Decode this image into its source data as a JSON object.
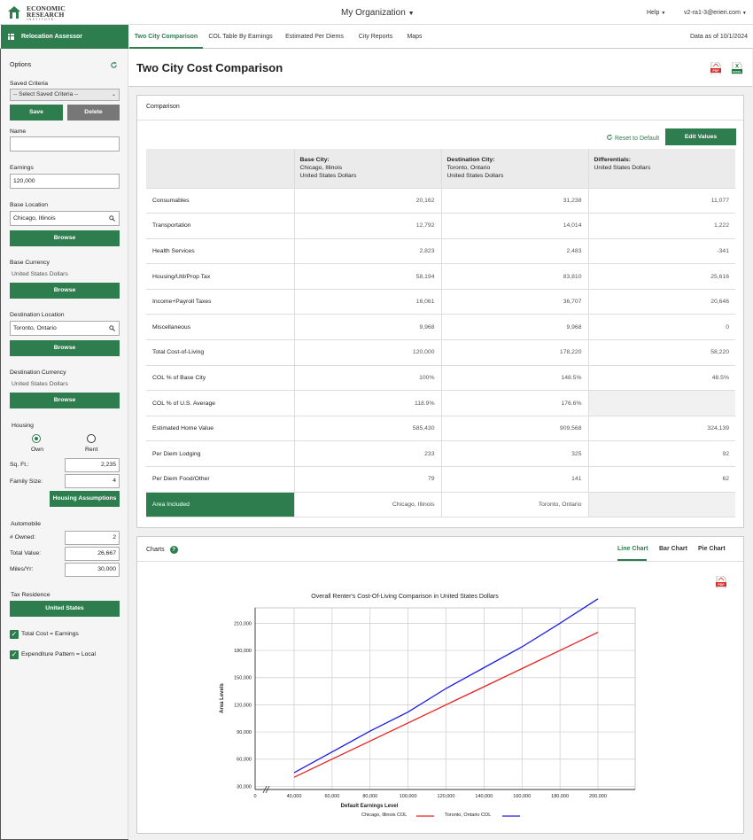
{
  "brand": {
    "line1": "ECONOMIC",
    "line2": "RESEARCH",
    "line3": "INSTITUTE"
  },
  "org_title": "My Organization",
  "help_label": "Help",
  "user_label": "v2-ra1-3@erieri.com",
  "app_name": "Relocation Assessor",
  "tabs": [
    {
      "label": "Two City Comparison",
      "active": true
    },
    {
      "label": "COL Table By Earnings",
      "active": false
    },
    {
      "label": "Estimated Per Diems",
      "active": false
    },
    {
      "label": "City Reports",
      "active": false
    },
    {
      "label": "Maps",
      "active": false
    }
  ],
  "data_as_of": "Data as of 10/1/2024",
  "sidebar": {
    "options_label": "Options",
    "saved_criteria_label": "Saved Criteria",
    "saved_criteria_placeholder": "-- Select Saved Criteria --",
    "save_label": "Save",
    "delete_label": "Delete",
    "name_label": "Name",
    "name_value": "",
    "earnings_label": "Earnings",
    "earnings_value": "120,000",
    "base_location_label": "Base Location",
    "base_location_value": "Chicago, Illinois",
    "browse_label": "Browse",
    "base_currency_label": "Base Currency",
    "base_currency_value": "United States Dollars",
    "dest_location_label": "Destination Location",
    "dest_location_value": "Toronto, Ontario",
    "dest_currency_label": "Destination Currency",
    "dest_currency_value": "United States Dollars",
    "housing_label": "Housing",
    "own_label": "Own",
    "rent_label": "Rent",
    "housing_selected": "Own",
    "sqft_label": "Sq. Ft.:",
    "sqft_value": "2,235",
    "family_label": "Family Size:",
    "family_value": "4",
    "housing_assumptions_label": "Housing Assumptions",
    "automobile_label": "Automobile",
    "owned_label": "# Owned:",
    "owned_value": "2",
    "total_value_label": "Total Value:",
    "total_value_value": "26,667",
    "miles_label": "Miles/Yr:",
    "miles_value": "30,000",
    "tax_residence_label": "Tax Residence",
    "tax_residence_value": "United States",
    "total_cost_label": "Total Cost = Earnings",
    "total_cost_checked": true,
    "expenditure_label": "Expenditure Pattern = Local",
    "expenditure_checked": true
  },
  "page_title": "Two City Cost Comparison",
  "comparison": {
    "panel_title": "Comparison",
    "reset_label": "Reset to Default",
    "edit_label": "Edit Values",
    "headers": [
      {
        "title": "Base City:",
        "line2": "Chicago, Illinois",
        "line3": "United States Dollars"
      },
      {
        "title": "Destination City:",
        "line2": "Toronto, Ontario",
        "line3": "United States Dollars"
      },
      {
        "title": "Differentials:",
        "line2": "United States Dollars",
        "line3": ""
      }
    ],
    "rows": [
      {
        "label": "Consumables",
        "base": "20,162",
        "dest": "31,238",
        "diff": "11,077"
      },
      {
        "label": "Transportation",
        "base": "12,792",
        "dest": "14,014",
        "diff": "1,222"
      },
      {
        "label": "Health Services",
        "base": "2,823",
        "dest": "2,483",
        "diff": "-341"
      },
      {
        "label": "Housing/Util/Prop Tax",
        "base": "58,194",
        "dest": "83,810",
        "diff": "25,616"
      },
      {
        "label": "Income+Payroll Taxes",
        "base": "16,061",
        "dest": "36,707",
        "diff": "20,646"
      },
      {
        "label": "Miscellaneous",
        "base": "9,968",
        "dest": "9,968",
        "diff": "0"
      },
      {
        "label": "Total Cost-of-Living",
        "base": "120,000",
        "dest": "178,220",
        "diff": "58,220"
      }
    ],
    "rows2": [
      {
        "label": "COL % of Base City",
        "base": "100%",
        "dest": "148.5%",
        "diff": "48.5%"
      },
      {
        "label": "COL % of U.S. Average",
        "base": "118.9%",
        "dest": "176.6%",
        "diff": ""
      },
      {
        "label": "Estimated Home Value",
        "base": "585,430",
        "dest": "909,568",
        "diff": "324,139"
      },
      {
        "label": "Per Diem Lodging",
        "base": "233",
        "dest": "325",
        "diff": "92"
      },
      {
        "label": "Per Diem Food/Other",
        "base": "79",
        "dest": "141",
        "diff": "62"
      }
    ],
    "area": {
      "label": "Area Included",
      "base": "Chicago, Illinois",
      "dest": "Toronto, Ontario"
    }
  },
  "charts": {
    "panel_title": "Charts",
    "tabs": [
      {
        "label": "Line Chart",
        "active": true
      },
      {
        "label": "Bar Chart",
        "active": false
      },
      {
        "label": "Pie Chart",
        "active": false
      }
    ]
  },
  "chart_data": {
    "type": "line",
    "title": "Overall Renter's Cost-Of-Living Comparison in United States Dollars",
    "xlabel": "Default Earnings Level",
    "ylabel": "Area Levels",
    "x_ticks": [
      "0",
      "40,000",
      "60,000",
      "80,000",
      "100,000",
      "120,000",
      "140,000",
      "160,000",
      "180,000",
      "200,000"
    ],
    "y_ticks": [
      "30,000",
      "60,000",
      "90,000",
      "120,000",
      "150,000",
      "180,000",
      "210,000"
    ],
    "xlim": [
      40000,
      200000
    ],
    "ylim": [
      30000,
      210000
    ],
    "axis_break": true,
    "grid": true,
    "legend_position": "bottom",
    "x": [
      40000,
      60000,
      80000,
      100000,
      120000,
      140000,
      160000,
      180000,
      200000
    ],
    "series": [
      {
        "name": "Chicago, Illinois COL",
        "color": "#e8211f",
        "values": [
          40000,
          60000,
          80000,
          100000,
          120000,
          140000,
          160000,
          180000,
          200000
        ]
      },
      {
        "name": "Toronto, Ontario COL",
        "color": "#1a1ae6",
        "values": [
          45000,
          68000,
          91000,
          112000,
          138000,
          161000,
          184000,
          210000,
          237000
        ]
      }
    ]
  }
}
